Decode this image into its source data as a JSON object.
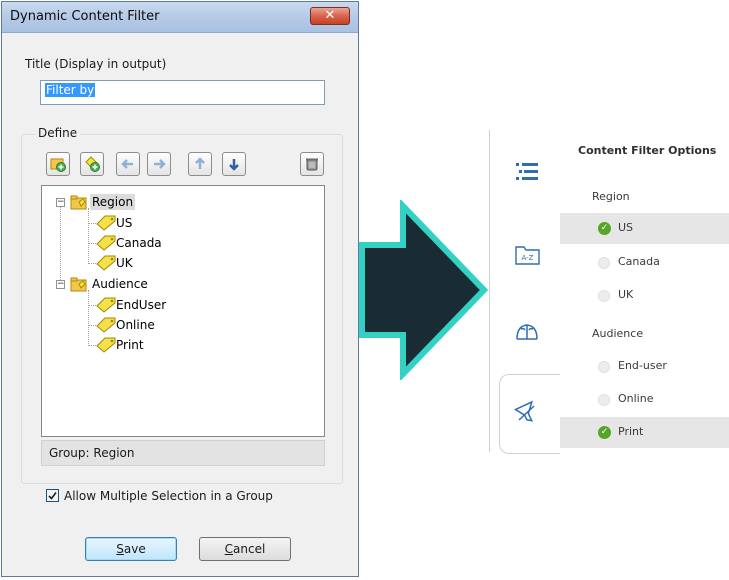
{
  "dialog": {
    "title": "Dynamic Content Filter",
    "close_glyph": "✕",
    "title_field_label": "Title (Display in output)",
    "title_field_value": "Filter by",
    "define_label": "Define",
    "toolbar_icons": [
      "add-group-icon",
      "add-tag-icon",
      "move-left-icon",
      "move-right-icon",
      "move-up-icon",
      "move-down-icon",
      "delete-icon"
    ],
    "tree": {
      "groups": [
        {
          "label": "Region",
          "items": [
            "US",
            "Canada",
            "UK"
          ]
        },
        {
          "label": "Audience",
          "items": [
            "EndUser",
            "Online",
            "Print"
          ]
        }
      ],
      "expander_glyph": "−"
    },
    "status": "Group: Region",
    "allow_multiple_label": "Allow Multiple Selection in a Group",
    "allow_multiple_checked": true,
    "save_label_u": "S",
    "save_label_rest": "ave",
    "cancel_label_u": "C",
    "cancel_label_rest": "ancel"
  },
  "arrow": {
    "fill": "#192b33",
    "stroke": "#33d1c4"
  },
  "panel": {
    "title": "Content Filter Options",
    "rail_icons": [
      "toc-list-icon",
      "index-az-icon",
      "glossary-book-icon",
      "filter-icon"
    ],
    "rail_icon_text": "A-Z",
    "groups": [
      {
        "label": "Region",
        "options": [
          {
            "label": "US",
            "checked": true
          },
          {
            "label": "Canada",
            "checked": false
          },
          {
            "label": "UK",
            "checked": false
          }
        ]
      },
      {
        "label": "Audience",
        "options": [
          {
            "label": "End-user",
            "checked": false
          },
          {
            "label": "Online",
            "checked": false
          },
          {
            "label": "Print",
            "checked": true
          }
        ]
      }
    ],
    "check_glyph": "✓",
    "accent": "#56a52a"
  }
}
